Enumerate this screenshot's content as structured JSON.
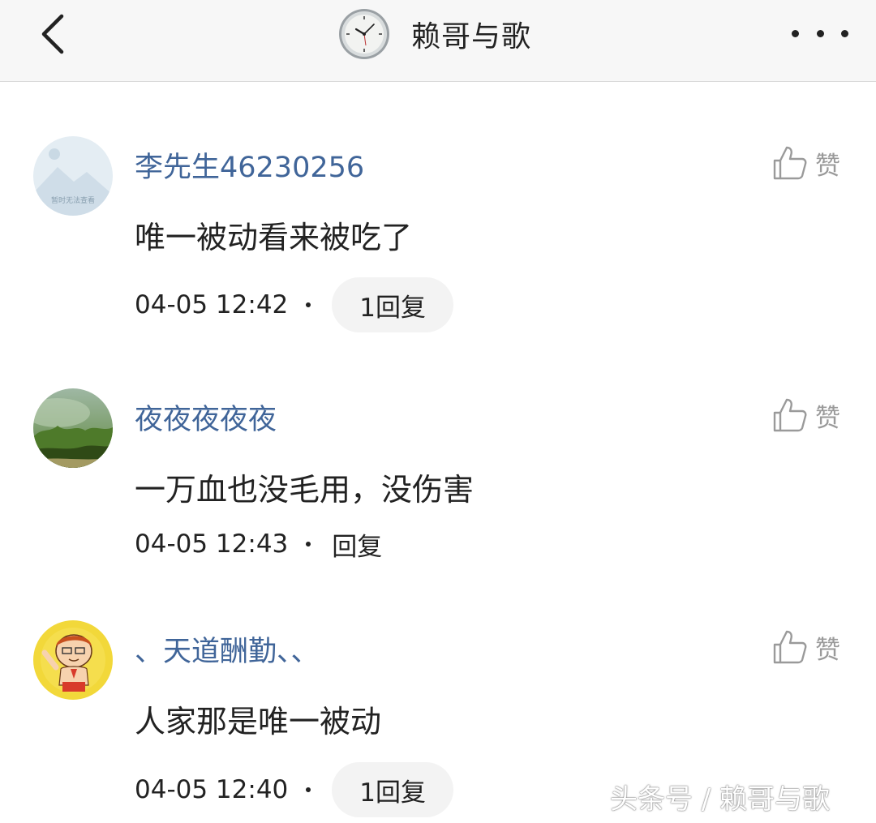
{
  "header": {
    "title": "赖哥与歌",
    "back_icon": "chevron-left-icon",
    "more_icon": "more-dots-icon"
  },
  "comments": [
    {
      "username": "李先生46230256",
      "avatar_text": "暂时无法查看",
      "content": "唯一被动看来被吃了",
      "time": "04-05 12:42",
      "reply_label": "1回复",
      "like_label": "赞"
    },
    {
      "username": "夜夜夜夜夜",
      "content": "一万血也没毛用，没伤害",
      "time": "04-05 12:43",
      "reply_label": "回复",
      "like_label": "赞"
    },
    {
      "username": "、天道酬勤、、",
      "content": "人家那是唯一被动",
      "time": "04-05 12:40",
      "reply_label": "1回复",
      "like_label": "赞"
    }
  ],
  "watermark": "头条号 / 赖哥与歌",
  "colors": {
    "username": "#406599",
    "text": "#222222",
    "like": "#9a9a9a",
    "pill_bg": "#f3f3f3"
  }
}
